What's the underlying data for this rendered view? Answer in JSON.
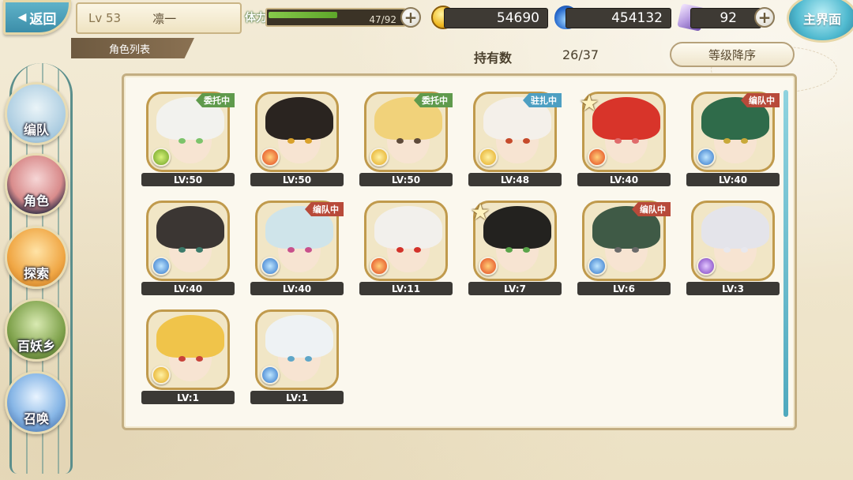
{
  "header": {
    "back_label": "返回",
    "player_level": "Lv 53",
    "player_name": "凛一",
    "stamina_label": "体力",
    "stamina_text": "47/92",
    "stamina_fraction": 0.511,
    "gold": "54690",
    "soul": "454132",
    "crystal": "92",
    "home_label": "主界面"
  },
  "subheader": {
    "tab_label": "角色列表",
    "owned_label": "持有数",
    "owned_count": "26/37",
    "sort_label": "等级降序"
  },
  "nav": [
    {
      "label": "编队"
    },
    {
      "label": "角色"
    },
    {
      "label": "探索"
    },
    {
      "label": "百妖乡"
    },
    {
      "label": "召唤"
    }
  ],
  "characters": [
    {
      "level": "LV:50",
      "tag": "委托中",
      "tag_color": "green",
      "element": "wind",
      "hair": "#f2f2ee",
      "eye": "#7cc36a",
      "star": false
    },
    {
      "level": "LV:50",
      "tag": "",
      "tag_color": "",
      "element": "fire",
      "hair": "#2a2420",
      "eye": "#d9a12a",
      "star": false
    },
    {
      "level": "LV:50",
      "tag": "委托中",
      "tag_color": "green",
      "element": "light",
      "hair": "#f1d27a",
      "eye": "#5e4a3a",
      "star": false
    },
    {
      "level": "LV:48",
      "tag": "驻扎中",
      "tag_color": "blue",
      "element": "light",
      "hair": "#f4f0ea",
      "eye": "#c64a2a",
      "star": false
    },
    {
      "level": "LV:40",
      "tag": "",
      "tag_color": "",
      "element": "fire",
      "hair": "#d8342a",
      "eye": "#e06a6a",
      "star": true
    },
    {
      "level": "LV:40",
      "tag": "编队中",
      "tag_color": "red",
      "element": "water",
      "hair": "#2f6b4a",
      "eye": "#c9a93a",
      "star": false
    },
    {
      "level": "LV:40",
      "tag": "",
      "tag_color": "",
      "element": "water",
      "hair": "#3b3633",
      "eye": "#3c7a6a",
      "star": false
    },
    {
      "level": "LV:40",
      "tag": "编队中",
      "tag_color": "red",
      "element": "water",
      "hair": "#cfe4ea",
      "eye": "#c8508c",
      "star": false
    },
    {
      "level": "LV:11",
      "tag": "",
      "tag_color": "",
      "element": "fire",
      "hair": "#f2f0ec",
      "eye": "#d3322a",
      "star": false
    },
    {
      "level": "LV:7",
      "tag": "",
      "tag_color": "",
      "element": "fire",
      "hair": "#23221f",
      "eye": "#5aa44a",
      "star": true
    },
    {
      "level": "LV:6",
      "tag": "编队中",
      "tag_color": "red",
      "element": "water",
      "hair": "#3f5a46",
      "eye": "#6a6a6a",
      "star": false
    },
    {
      "level": "LV:3",
      "tag": "",
      "tag_color": "",
      "element": "dark",
      "hair": "#e4e4ea",
      "eye": "#e8e8ee",
      "star": false
    },
    {
      "level": "LV:1",
      "tag": "",
      "tag_color": "",
      "element": "light",
      "hair": "#f0c44a",
      "eye": "#c8423a",
      "star": false
    },
    {
      "level": "LV:1",
      "tag": "",
      "tag_color": "",
      "element": "water",
      "hair": "#eef2f4",
      "eye": "#5ea6c8",
      "star": false
    }
  ],
  "colors": {
    "panel_border": "#c3ae82",
    "level_bar": "#3b3935",
    "accent_teal": "#4fa9be"
  }
}
